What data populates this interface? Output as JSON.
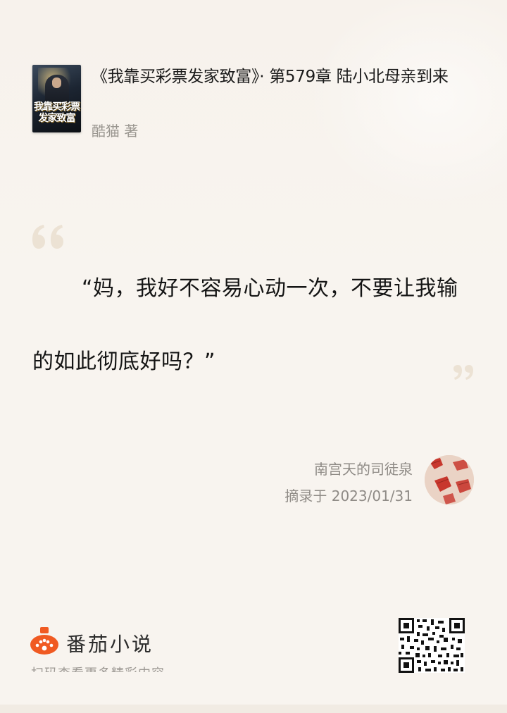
{
  "book": {
    "title": "《我靠买彩票发家致富》· 第579章 陆小北母亲到来",
    "author": "酷猫 著",
    "cover_title": "我靠买彩票发家致富"
  },
  "quote": {
    "text": "“妈，我好不容易心动一次，不要让我输的如此彻底好吗？”"
  },
  "excerpt": {
    "user": "南宫天的司徒泉",
    "date": "摘录于 2023/01/31"
  },
  "footer": {
    "app_name": "番茄小说",
    "hint": "扫码查看更多精彩内容"
  },
  "colors": {
    "background": "#f8f4ef",
    "quote_mark": "#ece2d4",
    "brand": "#f05a22"
  },
  "icons": {
    "open_quote": "open-quote-icon",
    "close_quote": "close-quote-icon",
    "app_logo": "tomato-logo-icon",
    "qr": "qr-code-icon"
  }
}
